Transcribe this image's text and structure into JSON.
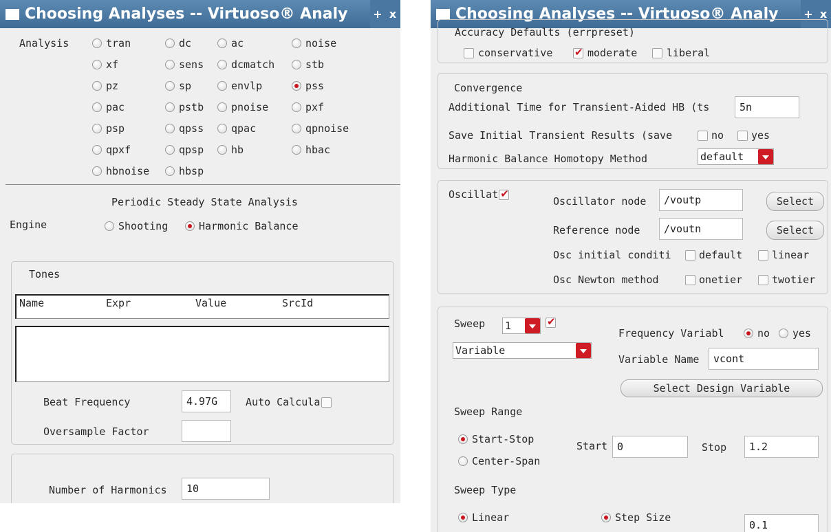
{
  "left": {
    "title": "Choosing Analyses -- Virtuoso® Analy",
    "title_btns": [
      "+",
      "x"
    ],
    "analysis_label": "Analysis",
    "analyses": [
      {
        "label": "tran",
        "selected": false
      },
      {
        "label": "dc",
        "selected": false
      },
      {
        "label": "ac",
        "selected": false
      },
      {
        "label": "noise",
        "selected": false
      },
      {
        "label": "xf",
        "selected": false
      },
      {
        "label": "sens",
        "selected": false
      },
      {
        "label": "dcmatch",
        "selected": false
      },
      {
        "label": "stb",
        "selected": false
      },
      {
        "label": "pz",
        "selected": false
      },
      {
        "label": "sp",
        "selected": false
      },
      {
        "label": "envlp",
        "selected": false
      },
      {
        "label": "pss",
        "selected": true
      },
      {
        "label": "pac",
        "selected": false
      },
      {
        "label": "pstb",
        "selected": false
      },
      {
        "label": "pnoise",
        "selected": false
      },
      {
        "label": "pxf",
        "selected": false
      },
      {
        "label": "psp",
        "selected": false
      },
      {
        "label": "qpss",
        "selected": false
      },
      {
        "label": "qpac",
        "selected": false
      },
      {
        "label": "qpnoise",
        "selected": false
      },
      {
        "label": "qpxf",
        "selected": false
      },
      {
        "label": "qpsp",
        "selected": false
      },
      {
        "label": "hb",
        "selected": false
      },
      {
        "label": "hbac",
        "selected": false
      },
      {
        "label": "hbnoise",
        "selected": false
      },
      {
        "label": "hbsp",
        "selected": false
      }
    ],
    "section_title": "Periodic Steady State Analysis",
    "engine_label": "Engine",
    "engine_shooting": "Shooting",
    "engine_hb": "Harmonic Balance",
    "tones_label": "Tones",
    "tones_columns": [
      "Name",
      "Expr",
      "Value",
      "SrcId"
    ],
    "beat_frequency_label": "Beat Frequency",
    "beat_frequency_value": "4.97G",
    "auto_calc_label": "Auto Calcula",
    "oversample_label": "Oversample Factor",
    "oversample_value": "",
    "harmonics_label": "Number of Harmonics",
    "harmonics_value": "10"
  },
  "right": {
    "title": "Choosing Analyses -- Virtuoso® Analy",
    "title_btns": [
      "+",
      "x"
    ],
    "accuracy_label": "Accuracy Defaults (errpreset)",
    "accuracy_conservative": "conservative",
    "accuracy_moderate": "moderate",
    "accuracy_liberal": "liberal",
    "convergence_label": "Convergence",
    "transient_aided_label": "Additional Time for Transient-Aided HB (ts",
    "transient_aided_value": "5n",
    "save_initial_label": "Save Initial Transient Results (save",
    "no_label": "no",
    "yes_label": "yes",
    "homotopy_label": "Harmonic Balance Homotopy Method",
    "homotopy_value": "default",
    "oscillator_label": "Oscillat",
    "osc_node_label": "Oscillator node",
    "osc_node_value": "/voutp",
    "ref_node_label": "Reference node",
    "ref_node_value": "/voutn",
    "select_label": "Select",
    "osc_init_label": "Osc initial conditi",
    "osc_init_default": "default",
    "osc_init_linear": "linear",
    "osc_newton_label": "Osc Newton method",
    "osc_newton_onetier": "onetier",
    "osc_newton_twotier": "twotier",
    "sweep_label": "Sweep",
    "sweep_count": "1",
    "freq_var_label": "Frequency Variabl",
    "sweep_type_value": "Variable",
    "var_name_label": "Variable Name",
    "var_name_value": "vcont",
    "select_design_var_label": "Select Design Variable",
    "sweep_range_label": "Sweep Range",
    "start_stop_label": "Start-Stop",
    "center_span_label": "Center-Span",
    "start_label": "Start",
    "start_value": "0",
    "stop_label": "Stop",
    "stop_value": "1.2",
    "sweep_type_label": "Sweep Type",
    "linear_label": "Linear",
    "step_size_label": "Step Size",
    "step_size_value": "0.1"
  }
}
